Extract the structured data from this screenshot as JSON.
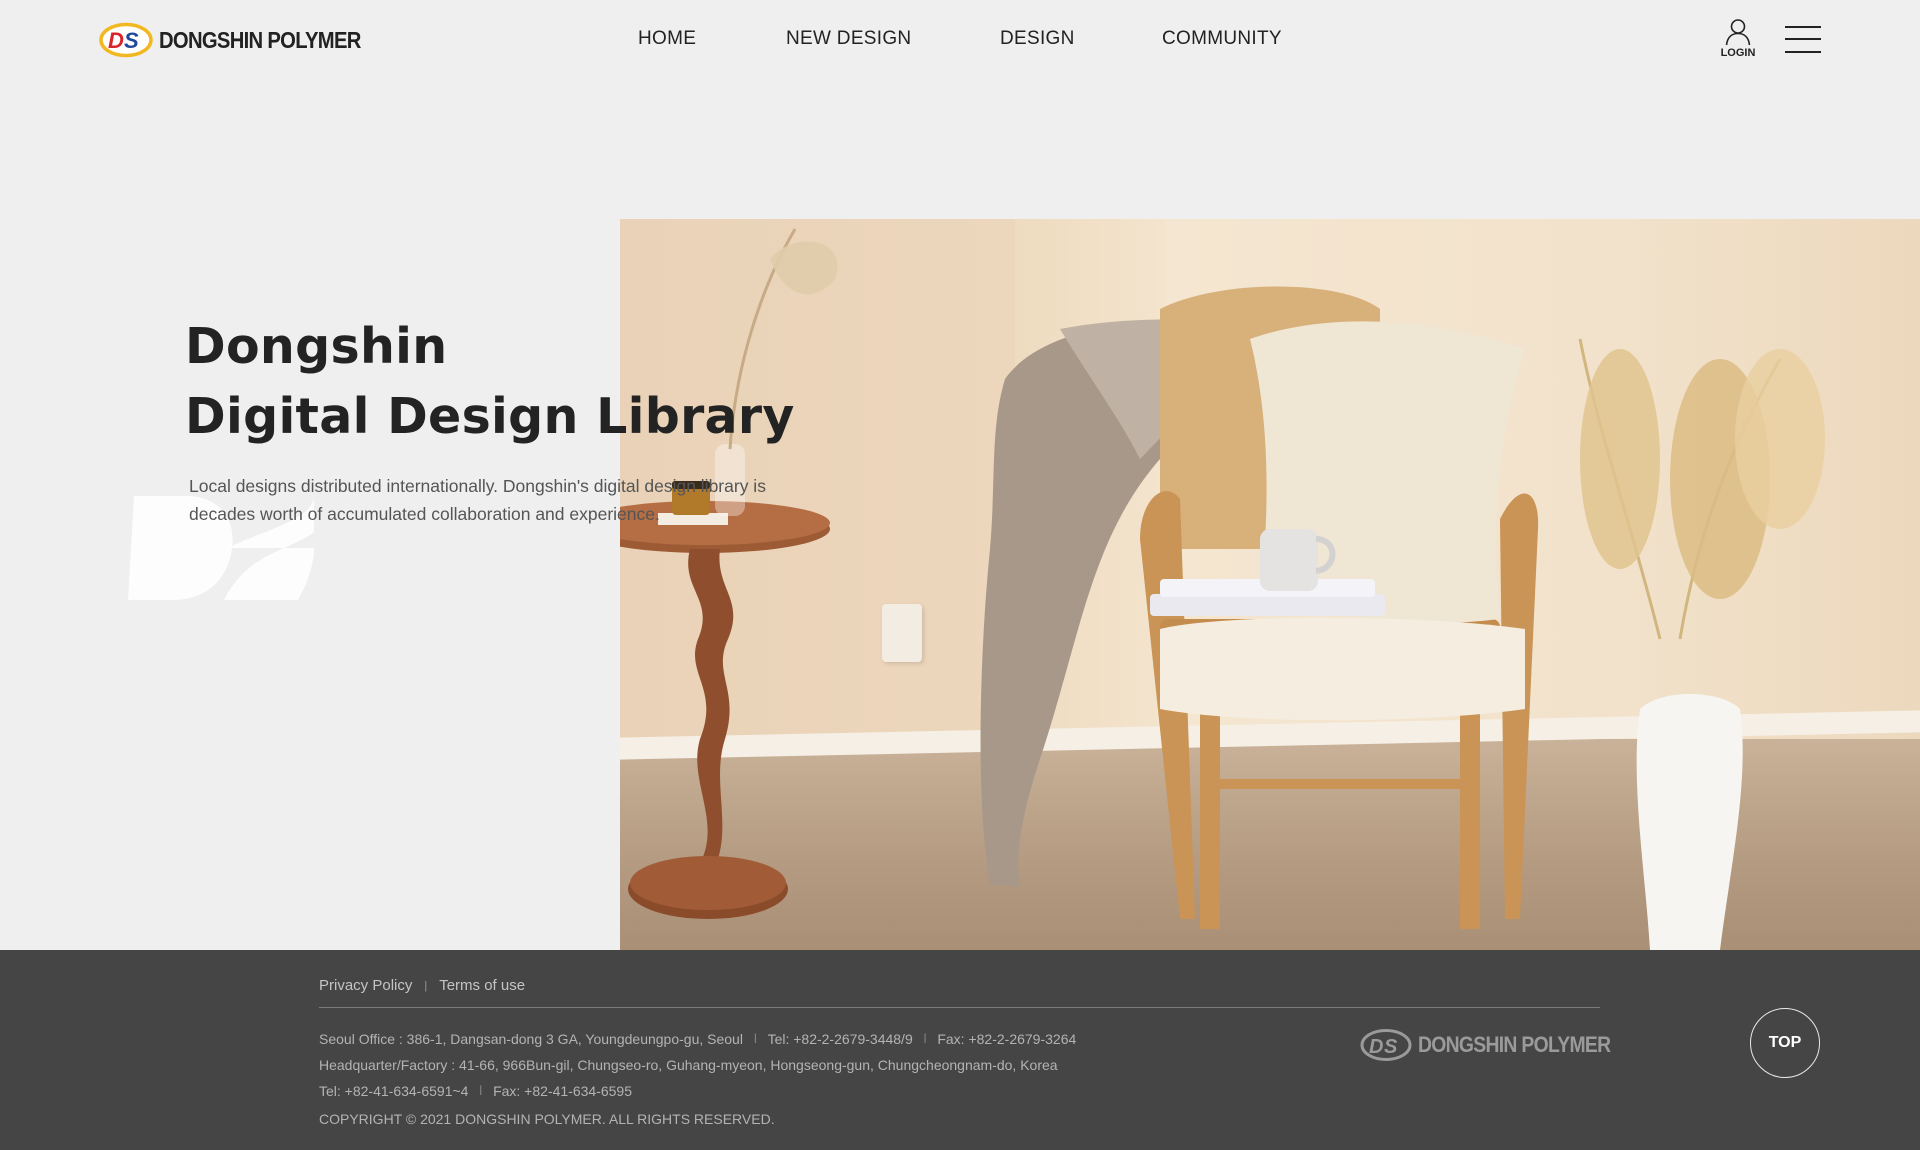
{
  "brand": {
    "name": "DONGSHIN POLYMER",
    "logo_initials": "DS",
    "logo_colors": {
      "ring": "#f2b821",
      "d": "#d8242a",
      "s": "#1f4a9c"
    }
  },
  "nav": {
    "items": [
      {
        "label": "HOME"
      },
      {
        "label": "NEW DESIGN"
      },
      {
        "label": "DESIGN"
      },
      {
        "label": "COMMUNITY"
      }
    ],
    "login_label": "LOGIN",
    "login_icon": "user-icon",
    "menu_icon": "hamburger-menu-icon"
  },
  "hero": {
    "title_line1": "Dongshin",
    "title_line2": "Digital Design Library",
    "description_line1": "Local designs distributed internationally. Dongshin's digital design library is",
    "description_line2": "decades worth of accumulated collaboration and experience.",
    "watermark_initials": "DS"
  },
  "footer": {
    "links": [
      {
        "label": "Privacy Policy"
      },
      {
        "label": "Terms of use"
      }
    ],
    "separator": "|",
    "seoul_office": "Seoul Office : 386-1, Dangsan-dong 3 GA, Youngdeungpo-gu, Seoul",
    "seoul_tel": "Tel: +82-2-2679-3448/9",
    "seoul_fax": "Fax: +82-2-2679-3264",
    "headquarter": "Headquarter/Factory : 41-66, 966Bun-gil, Chungseo-ro, Guhang-myeon, Hongseong-gun, Chungcheongnam-do, Korea",
    "hq_tel": "Tel: +82-41-634-6591~4",
    "hq_fax": "Fax:  +82-41-634-6595",
    "copyright": "COPYRIGHT © 2021 DONGSHIN POLYMER. ALL RIGHTS RESERVED.",
    "logo_text": "DONGSHIN POLYMER",
    "top_label": "TOP"
  },
  "colors": {
    "page_background": "#efefef",
    "footer_background": "#454545",
    "text_dark": "#222222"
  }
}
